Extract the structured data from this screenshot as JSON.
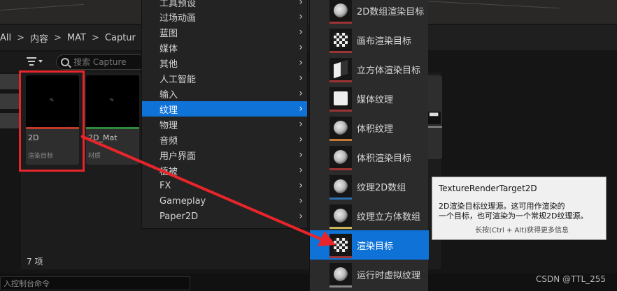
{
  "breadcrumb": {
    "items": [
      "All",
      "内容",
      "MAT",
      "Captur"
    ],
    "separators": [
      ">",
      ">",
      ">"
    ]
  },
  "search": {
    "placeholder": "搜索 Capture"
  },
  "assets": [
    {
      "name": "2D",
      "type": "渲染目标",
      "bar_color": "#c0392b"
    },
    {
      "name": "2D_Mat",
      "type": "材质",
      "bar_color": "#2e8b3d"
    }
  ],
  "status": {
    "item_count": "7 项"
  },
  "console": {
    "placeholder": "入控制台命令"
  },
  "watermark": "CSDN @TTL_255",
  "category_menu": {
    "items": [
      {
        "label": "工具预设"
      },
      {
        "label": "过场动画"
      },
      {
        "label": "蓝图"
      },
      {
        "label": "媒体"
      },
      {
        "label": "其他"
      },
      {
        "label": "人工智能"
      },
      {
        "label": "输入"
      },
      {
        "label": "纹理"
      },
      {
        "label": "物理"
      },
      {
        "label": "音频"
      },
      {
        "label": "用户界面"
      },
      {
        "label": "植被"
      },
      {
        "label": "FX"
      },
      {
        "label": "Gameplay"
      },
      {
        "label": "Paper2D"
      }
    ],
    "active_label": "纹理"
  },
  "texture_menu": {
    "items": [
      {
        "label": "2D数组渲染目标",
        "icon": "cube-icon",
        "bar_color": "#9b3434"
      },
      {
        "label": "画布渲染目标",
        "icon": "checker-icon",
        "bar_color": "#9b3434"
      },
      {
        "label": "立方体渲染目标",
        "icon": "checker-cube-icon",
        "bar_color": "#9b3434"
      },
      {
        "label": "媒体纹理",
        "icon": "tv-icon",
        "bar_color": "#9b3434"
      },
      {
        "label": "体积纹理",
        "icon": "cube-icon",
        "bar_color": "#c47a32"
      },
      {
        "label": "体积渲染目标",
        "icon": "cube-icon",
        "bar_color": "#9b3434"
      },
      {
        "label": "纹理2D数组",
        "icon": "cube-icon",
        "bar_color": "#2c6fb0"
      },
      {
        "label": "纹理立方体数组",
        "icon": "cube-icon",
        "bar_color": "#c9b45a"
      },
      {
        "label": "渲染目标",
        "icon": "checker-icon",
        "bar_color": "#9b3434"
      },
      {
        "label": "运行时虚拟纹理",
        "icon": "cube-icon",
        "bar_color": "#8a8a8a"
      }
    ],
    "active_label": "渲染目标"
  },
  "tooltip": {
    "title": "TextureRenderTarget2D",
    "description": "2D渲染目标纹理源。这可用作渲染的\n一个目标，也可渲染为一个常规2D纹理源。",
    "hint": "长按(Ctrl + Alt)获得更多信息"
  },
  "colors": {
    "accent": "#0f72d6",
    "annotation_red": "#e8252a",
    "tooltip_bg": "#f0f0f0"
  }
}
